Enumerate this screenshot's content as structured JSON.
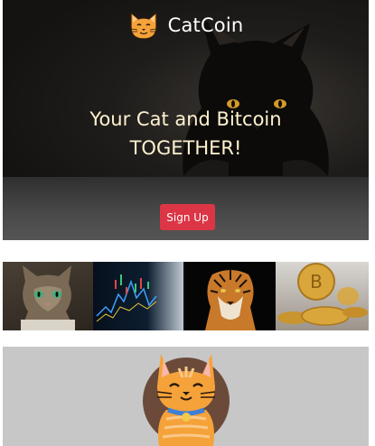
{
  "brand": {
    "name": "CatCoin",
    "logo_icon": "cat-face-icon"
  },
  "hero": {
    "headline_line1": "Your Cat and Bitcoin",
    "headline_line2": "TOGETHER!",
    "signup_label": "Sign Up"
  },
  "gallery": {
    "images": [
      "cat-photo",
      "trading-chart-photo",
      "tiger-photo",
      "bitcoin-coins-photo"
    ]
  },
  "mascot": {
    "icon": "cat-mascot-icon"
  },
  "colors": {
    "accent": "#dc3545",
    "headline": "#fff2cf",
    "bottom_bg": "#c7c7c7"
  }
}
